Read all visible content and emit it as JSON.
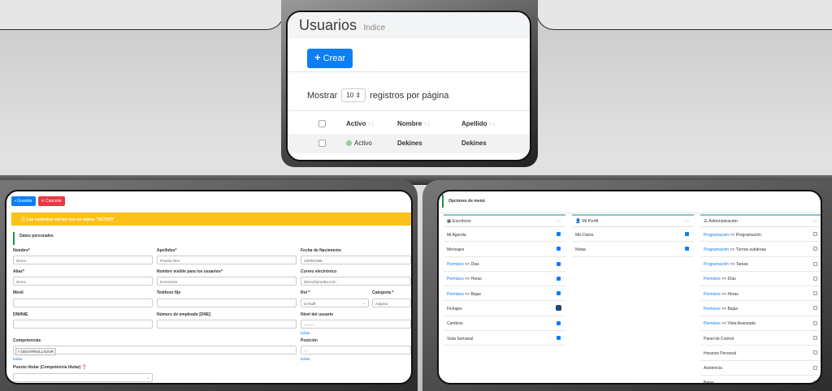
{
  "usuarios": {
    "title": "Usuarios",
    "subtitle": "Indice",
    "create_button": "Crear",
    "show_prefix": "Mostrar",
    "page_size": "10",
    "show_suffix": "registros por página",
    "columns": [
      "Activo",
      "Nombre",
      "Apellido"
    ],
    "rows": [
      {
        "activo": "Activo",
        "nombre": "Dekines",
        "apellido": "Dekines"
      }
    ]
  },
  "form": {
    "save_button": "Guardar",
    "cancel_button": "Cancelar",
    "alert": "Los contratos inician con un status \"ACTIVO\"",
    "section": "Datos personales",
    "fields": {
      "nombre": {
        "label": "Nombre*",
        "value": "Demo"
      },
      "apellidos": {
        "label": "Apellidos*",
        "value": "Prueba Test"
      },
      "nacimiento": {
        "label": "Fecha de Nacimiento",
        "value": "10/06/1986"
      },
      "alias": {
        "label": "Alias*",
        "value": "Demo"
      },
      "nombre_visible": {
        "label": "Nombre visible para los usuarios*",
        "value": "DemoUser"
      },
      "correo": {
        "label": "Correo electrónico",
        "value": "demo@prueba.com"
      },
      "movil": {
        "label": "Móvil",
        "value": ""
      },
      "telefono": {
        "label": "Teléfono fijo",
        "value": ""
      },
      "rol": {
        "label": "Rol *",
        "value": "Id-Staff"
      },
      "categoria": {
        "label": "Categoría *",
        "value": "Adjunto"
      },
      "dni": {
        "label": "DNI/NIE",
        "value": ""
      },
      "empleado": {
        "label": "Número de empleado [DNE]",
        "value": ""
      },
      "nivel": {
        "label": "Nivel del usuario",
        "value": "--------"
      },
      "competencias": {
        "label": "Competencias",
        "value": "× DESARROLLADOR"
      },
      "posicion": {
        "label": "Posición",
        "value": "---"
      },
      "puesto": {
        "label": "Puesto titular (Competencia titular)",
        "value": ""
      }
    },
    "edit_link": "Editar",
    "edit_link_nivel": "Editar",
    "edit_link_posicion": "Editar"
  },
  "menu": {
    "title": "Opciones de menú",
    "columns": [
      {
        "name": "Escritorio",
        "icon": "calendar-icon",
        "items": [
          {
            "label": "Mi Agenda",
            "checked": true
          },
          {
            "label": "Mensajes",
            "checked": true
          },
          {
            "link": "Permisos",
            "rest": " << Días",
            "checked": true
          },
          {
            "link": "Permisos",
            "rest": " << Horas",
            "checked": true
          },
          {
            "link": "Permisos",
            "rest": " << Bajas",
            "checked": true
          },
          {
            "label": "Fichajes",
            "checked": true,
            "focused": true
          },
          {
            "label": "Cambios",
            "checked": true
          },
          {
            "label": "Vista Semanal",
            "checked": true
          }
        ]
      },
      {
        "name": "Mi Perfil",
        "icon": "user-icon",
        "items": [
          {
            "label": "Mis Datos",
            "checked": true
          },
          {
            "label": "Notas",
            "checked": true
          }
        ]
      },
      {
        "name": "Administración",
        "icon": "list-icon",
        "items": [
          {
            "link": "Programación",
            "rest": " << Programación",
            "checked": false
          },
          {
            "link": "Programación",
            "rest": " << Turnos subáreas",
            "checked": false
          },
          {
            "link": "Programación",
            "rest": " << Tareas",
            "checked": false
          },
          {
            "link": "Permisos",
            "rest": " << Días",
            "checked": false
          },
          {
            "link": "Permisos",
            "rest": " << Horas",
            "checked": false
          },
          {
            "link": "Permisos",
            "rest": " << Bajas",
            "checked": false
          },
          {
            "link": "Permisos",
            "rest": " << Vista Avanzada",
            "checked": false
          },
          {
            "label": "Panel de Control",
            "checked": false
          },
          {
            "label": "Horarios Personal",
            "checked": false
          },
          {
            "label": "Asistencia",
            "checked": false
          },
          {
            "label": "Bajas",
            "checked": false
          }
        ]
      }
    ],
    "collapse_symbol": "..."
  }
}
